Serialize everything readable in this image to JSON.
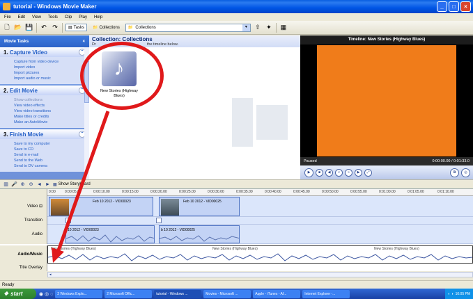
{
  "window": {
    "title": "tutorial - Windows Movie Maker"
  },
  "menu": [
    "File",
    "Edit",
    "View",
    "Tools",
    "Clip",
    "Play",
    "Help"
  ],
  "toolbar": {
    "tasks_label": "Tasks",
    "collections_label": "Collections",
    "collections_select": "Collections"
  },
  "taskpane": {
    "header": "Movie Tasks",
    "sections": [
      {
        "num": "1.",
        "title": "Capture Video",
        "links": [
          "Capture from video device",
          "Import video",
          "Import pictures",
          "Import audio or music"
        ]
      },
      {
        "num": "2.",
        "title": "Edit Movie",
        "links": [
          "Show collections",
          "View video effects",
          "View video transitions",
          "Make titles or credits",
          "Make an AutoMovie"
        ]
      },
      {
        "num": "3.",
        "title": "Finish Movie",
        "links": [
          "Save to my computer",
          "Save to CD",
          "Send in e-mail",
          "Send to the Web",
          "Send to DV camera"
        ]
      }
    ]
  },
  "collections": {
    "title": "Collection: Collections",
    "subtitle_start": "Dr",
    "subtitle_end": "the timeline below.",
    "item_label": "New Stories (Highway Blues)"
  },
  "preview": {
    "title": "Timeline: New Stories (Highway Blues)",
    "status": "Paused",
    "time": "0:00:00.00 / 0:01:33.0",
    "screen_color": "#f07c1a"
  },
  "storyboard": {
    "show_label": "Show Storyboard"
  },
  "timeline": {
    "ticks": [
      "0:00",
      "0:00:05.00",
      "0:00:10.00",
      "0:00:15.00",
      "0:00:20.00",
      "0:00:25.00",
      "0:00:30.00",
      "0:00:35.00",
      "0:00:40.00",
      "0:00:45.00",
      "0:00:50.00",
      "0:00:55.00",
      "0:01:00.00",
      "0:01:05.00",
      "0:01:10.00"
    ],
    "tracks": {
      "video": "Video",
      "transition": "Transition",
      "audio": "Audio",
      "audio_music": "Audio/Music",
      "title_overlay": "Title Overlay"
    },
    "video_clips": [
      "Feb 10 2012 - VID00023",
      "Feb 10 2012 - VID00025"
    ],
    "audio_clips": [
      "10 2012 - VID00023",
      "b 10 2012 - VID00025"
    ],
    "music_clips": [
      "New Stories (Highway Blues)",
      "New Stories (Highway Blues)",
      "New Stories (Highway Blues)"
    ]
  },
  "statusbar": {
    "text": "Ready"
  },
  "taskbar": {
    "start": "start",
    "tasks": [
      "2 Windows Explo...",
      "2 Microsoft Offic...",
      "tutorial - Windows ...",
      "Movies - Microsoft ...",
      "Apple - iTunes - Af...",
      "Internet Explorer -..."
    ],
    "clock": "10:05 PM"
  },
  "colors": {
    "annotation": "#e0191b",
    "accent": "#215dc6"
  }
}
